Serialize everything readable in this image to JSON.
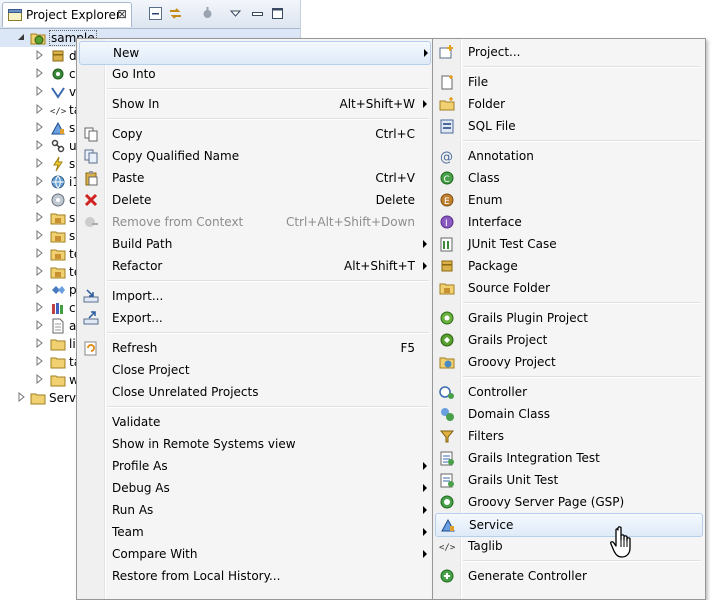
{
  "explorer": {
    "tab_label": "Project Explorer",
    "close_glyph": "⊠",
    "toolbar_icons": [
      "collapse-all-icon",
      "link-with-editor-icon",
      "filters-icon",
      "view-menu-icon",
      "minimize-icon",
      "maximize-icon"
    ],
    "root_label": "sample",
    "children": [
      {
        "label": "d",
        "icon": "package-icon"
      },
      {
        "label": "c",
        "icon": "gear-icon"
      },
      {
        "label": "v",
        "icon": "views-icon"
      },
      {
        "label": "ta",
        "icon": "taglib-icon"
      },
      {
        "label": "s",
        "icon": "service-icon"
      },
      {
        "label": "u",
        "icon": "url-mapping-icon"
      },
      {
        "label": "s",
        "icon": "script-icon"
      },
      {
        "label": "i1",
        "icon": "i18n-icon"
      },
      {
        "label": "c",
        "icon": "conf-icon"
      },
      {
        "label": "s",
        "icon": "source-folder-icon"
      },
      {
        "label": "s",
        "icon": "source-folder-icon"
      },
      {
        "label": "te",
        "icon": "source-folder-icon"
      },
      {
        "label": "te",
        "icon": "source-folder-icon"
      },
      {
        "label": "p",
        "icon": "plugin-icon"
      },
      {
        "label": "c",
        "icon": "library-icon"
      },
      {
        "label": "a",
        "icon": "file-icon"
      },
      {
        "label": "li",
        "icon": "folder-icon"
      },
      {
        "label": "ta",
        "icon": "folder-icon"
      },
      {
        "label": "w",
        "icon": "folder-icon"
      }
    ],
    "servers_label": "Serve"
  },
  "context_menu": {
    "items": [
      {
        "label": "New",
        "shortcut": "",
        "submenu": true,
        "icon": "",
        "disabled": false,
        "hover": true
      },
      {
        "label": "Go Into",
        "shortcut": "",
        "submenu": false,
        "icon": "",
        "disabled": false
      },
      {
        "sep": true
      },
      {
        "label": "Show In",
        "shortcut": "Alt+Shift+W",
        "submenu": true,
        "icon": "",
        "disabled": false
      },
      {
        "sep": true
      },
      {
        "label": "Copy",
        "shortcut": "Ctrl+C",
        "submenu": false,
        "icon": "copy-icon",
        "disabled": false
      },
      {
        "label": "Copy Qualified Name",
        "shortcut": "",
        "submenu": false,
        "icon": "copy-qualified-icon",
        "disabled": false
      },
      {
        "label": "Paste",
        "shortcut": "Ctrl+V",
        "submenu": false,
        "icon": "paste-icon",
        "disabled": false
      },
      {
        "label": "Delete",
        "shortcut": "Delete",
        "submenu": false,
        "icon": "delete-icon",
        "disabled": false
      },
      {
        "label": "Remove from Context",
        "shortcut": "Ctrl+Alt+Shift+Down",
        "submenu": false,
        "icon": "remove-context-icon",
        "disabled": true
      },
      {
        "label": "Build Path",
        "shortcut": "",
        "submenu": true,
        "icon": "",
        "disabled": false
      },
      {
        "label": "Refactor",
        "shortcut": "Alt+Shift+T",
        "submenu": true,
        "icon": "",
        "disabled": false
      },
      {
        "sep": true
      },
      {
        "label": "Import...",
        "shortcut": "",
        "submenu": false,
        "icon": "import-icon",
        "disabled": false
      },
      {
        "label": "Export...",
        "shortcut": "",
        "submenu": false,
        "icon": "export-icon",
        "disabled": false
      },
      {
        "sep": true
      },
      {
        "label": "Refresh",
        "shortcut": "F5",
        "submenu": false,
        "icon": "refresh-icon",
        "disabled": false
      },
      {
        "label": "Close Project",
        "shortcut": "",
        "submenu": false,
        "icon": "",
        "disabled": false
      },
      {
        "label": "Close Unrelated Projects",
        "shortcut": "",
        "submenu": false,
        "icon": "",
        "disabled": false
      },
      {
        "sep": true
      },
      {
        "label": "Validate",
        "shortcut": "",
        "submenu": false,
        "icon": "",
        "disabled": false
      },
      {
        "label": "Show in Remote Systems view",
        "shortcut": "",
        "submenu": false,
        "icon": "",
        "disabled": false
      },
      {
        "label": "Profile As",
        "shortcut": "",
        "submenu": true,
        "icon": "",
        "disabled": false
      },
      {
        "label": "Debug As",
        "shortcut": "",
        "submenu": true,
        "icon": "",
        "disabled": false
      },
      {
        "label": "Run As",
        "shortcut": "",
        "submenu": true,
        "icon": "",
        "disabled": false
      },
      {
        "label": "Team",
        "shortcut": "",
        "submenu": true,
        "icon": "",
        "disabled": false
      },
      {
        "label": "Compare With",
        "shortcut": "",
        "submenu": true,
        "icon": "",
        "disabled": false
      },
      {
        "label": "Restore from Local History...",
        "shortcut": "",
        "submenu": false,
        "icon": "",
        "disabled": false
      }
    ]
  },
  "new_submenu": {
    "items": [
      {
        "label": "Project...",
        "icon": "new-project-icon"
      },
      {
        "sep": true
      },
      {
        "label": "File",
        "icon": "new-file-icon"
      },
      {
        "label": "Folder",
        "icon": "new-folder-icon"
      },
      {
        "label": "SQL File",
        "icon": "sql-file-icon"
      },
      {
        "sep": true
      },
      {
        "label": "Annotation",
        "icon": "annotation-icon"
      },
      {
        "label": "Class",
        "icon": "class-icon"
      },
      {
        "label": "Enum",
        "icon": "enum-icon"
      },
      {
        "label": "Interface",
        "icon": "interface-icon"
      },
      {
        "label": "JUnit Test Case",
        "icon": "junit-icon"
      },
      {
        "label": "Package",
        "icon": "package-icon"
      },
      {
        "label": "Source Folder",
        "icon": "source-folder-icon"
      },
      {
        "sep": true
      },
      {
        "label": "Grails Plugin Project",
        "icon": "grails-plugin-icon"
      },
      {
        "label": "Grails Project",
        "icon": "grails-project-icon"
      },
      {
        "label": "Groovy Project",
        "icon": "groovy-project-icon"
      },
      {
        "sep": true
      },
      {
        "label": "Controller",
        "icon": "controller-icon"
      },
      {
        "label": "Domain Class",
        "icon": "domain-class-icon"
      },
      {
        "label": "Filters",
        "icon": "filters-icon"
      },
      {
        "label": "Grails Integration Test",
        "icon": "integration-test-icon"
      },
      {
        "label": "Grails Unit Test",
        "icon": "unit-test-icon"
      },
      {
        "label": "Groovy Server Page (GSP)",
        "icon": "gsp-icon"
      },
      {
        "label": "Service",
        "icon": "service-icon",
        "hover": true
      },
      {
        "label": "Taglib",
        "icon": "taglib-icon"
      },
      {
        "sep": true
      },
      {
        "label": "Generate Controller",
        "icon": "generate-controller-icon"
      }
    ]
  }
}
